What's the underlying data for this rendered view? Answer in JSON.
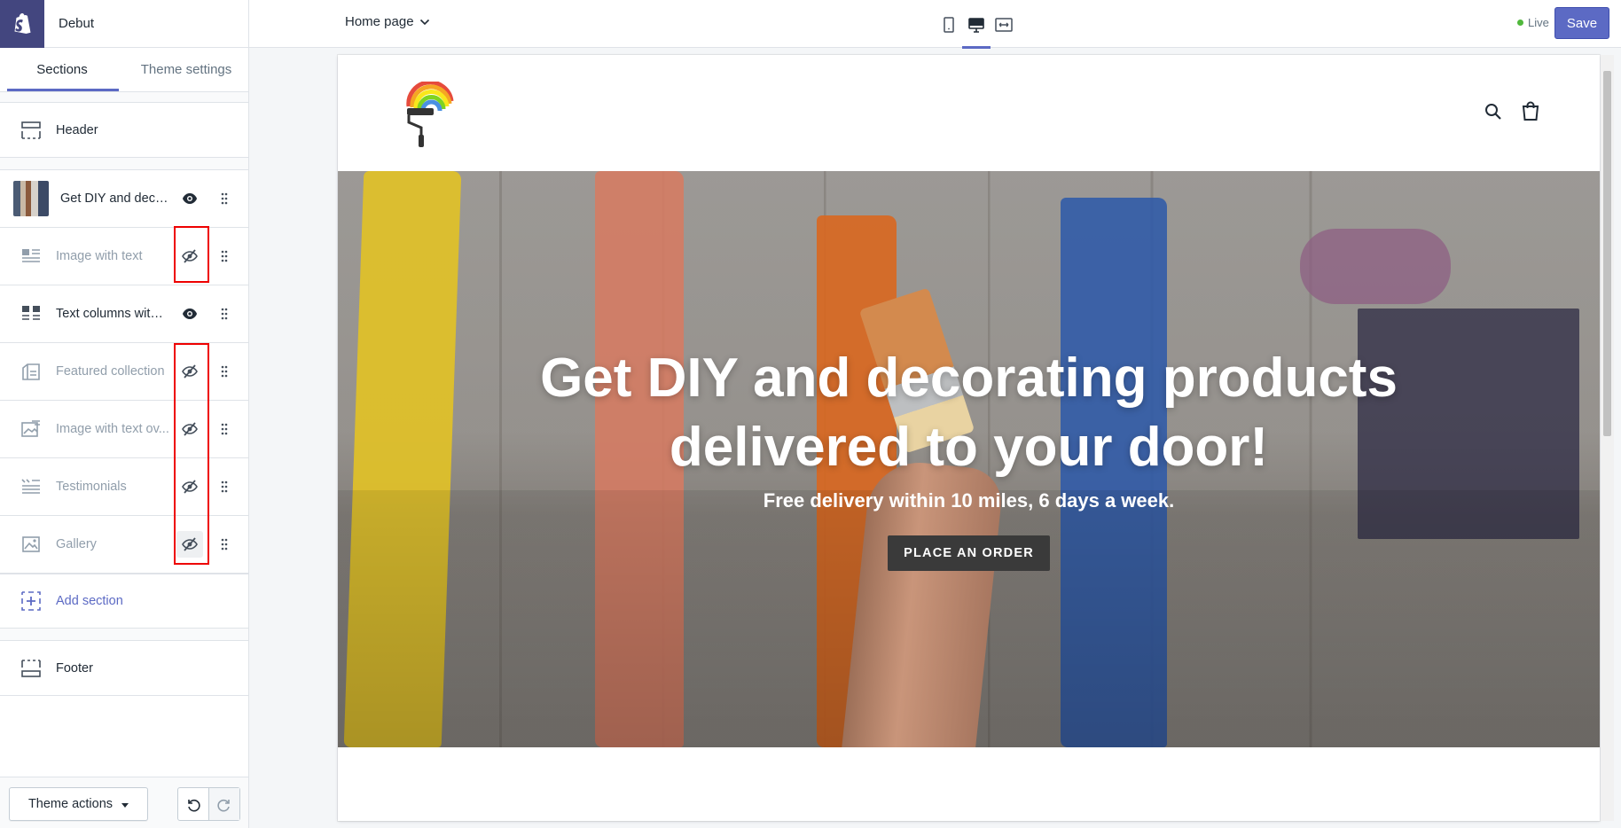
{
  "app": {
    "name": "Debut"
  },
  "sidebar": {
    "tabs": [
      {
        "label": "Sections",
        "active": true
      },
      {
        "label": "Theme settings",
        "active": false
      }
    ],
    "header_item": {
      "label": "Header",
      "icon": "header-layout-icon"
    },
    "sections": [
      {
        "label": "Get DIY and decor...",
        "visible": true,
        "icon": "thumbnail-image"
      },
      {
        "label": "Image with text",
        "visible": false,
        "icon": "image-text-icon"
      },
      {
        "label": "Text columns with i...",
        "visible": true,
        "icon": "text-columns-icon"
      },
      {
        "label": "Featured collection",
        "visible": false,
        "icon": "collection-icon"
      },
      {
        "label": "Image with text ov...",
        "visible": false,
        "icon": "image-overlay-icon"
      },
      {
        "label": "Testimonials",
        "visible": false,
        "icon": "testimonials-icon"
      },
      {
        "label": "Gallery",
        "visible": false,
        "icon": "gallery-icon"
      }
    ],
    "add_section": {
      "label": "Add section"
    },
    "footer_item": {
      "label": "Footer",
      "icon": "footer-layout-icon"
    },
    "theme_actions_label": "Theme actions"
  },
  "topbar": {
    "page_selector": "Home page",
    "devices": [
      "mobile-device-icon",
      "desktop-device-icon",
      "fullwidth-device-icon"
    ],
    "active_device": "desktop-device-icon",
    "status": "Live",
    "save_label": "Save"
  },
  "preview": {
    "hero": {
      "title_line1": "Get DIY and decorating products",
      "title_line2": "delivered to your door!",
      "subtitle": "Free delivery within 10 miles, 6 days a week.",
      "button_label": "PLACE AN ORDER"
    }
  },
  "colors": {
    "accent": "#5c6ac4",
    "brand_dark": "#43467f",
    "live_dot": "#50b83c",
    "highlight_box": "#ee0000"
  }
}
